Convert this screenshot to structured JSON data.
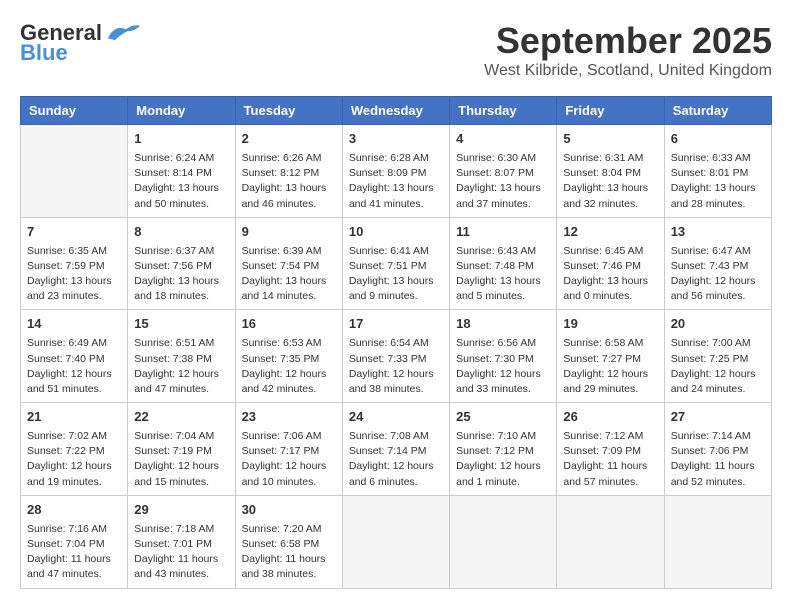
{
  "header": {
    "logo_main": "General",
    "logo_sub": "Blue",
    "month_title": "September 2025",
    "subtitle": "West Kilbride, Scotland, United Kingdom"
  },
  "weekdays": [
    "Sunday",
    "Monday",
    "Tuesday",
    "Wednesday",
    "Thursday",
    "Friday",
    "Saturday"
  ],
  "weeks": [
    [
      {
        "day": "",
        "info": ""
      },
      {
        "day": "1",
        "info": "Sunrise: 6:24 AM\nSunset: 8:14 PM\nDaylight: 13 hours\nand 50 minutes."
      },
      {
        "day": "2",
        "info": "Sunrise: 6:26 AM\nSunset: 8:12 PM\nDaylight: 13 hours\nand 46 minutes."
      },
      {
        "day": "3",
        "info": "Sunrise: 6:28 AM\nSunset: 8:09 PM\nDaylight: 13 hours\nand 41 minutes."
      },
      {
        "day": "4",
        "info": "Sunrise: 6:30 AM\nSunset: 8:07 PM\nDaylight: 13 hours\nand 37 minutes."
      },
      {
        "day": "5",
        "info": "Sunrise: 6:31 AM\nSunset: 8:04 PM\nDaylight: 13 hours\nand 32 minutes."
      },
      {
        "day": "6",
        "info": "Sunrise: 6:33 AM\nSunset: 8:01 PM\nDaylight: 13 hours\nand 28 minutes."
      }
    ],
    [
      {
        "day": "7",
        "info": "Sunrise: 6:35 AM\nSunset: 7:59 PM\nDaylight: 13 hours\nand 23 minutes."
      },
      {
        "day": "8",
        "info": "Sunrise: 6:37 AM\nSunset: 7:56 PM\nDaylight: 13 hours\nand 18 minutes."
      },
      {
        "day": "9",
        "info": "Sunrise: 6:39 AM\nSunset: 7:54 PM\nDaylight: 13 hours\nand 14 minutes."
      },
      {
        "day": "10",
        "info": "Sunrise: 6:41 AM\nSunset: 7:51 PM\nDaylight: 13 hours\nand 9 minutes."
      },
      {
        "day": "11",
        "info": "Sunrise: 6:43 AM\nSunset: 7:48 PM\nDaylight: 13 hours\nand 5 minutes."
      },
      {
        "day": "12",
        "info": "Sunrise: 6:45 AM\nSunset: 7:46 PM\nDaylight: 13 hours\nand 0 minutes."
      },
      {
        "day": "13",
        "info": "Sunrise: 6:47 AM\nSunset: 7:43 PM\nDaylight: 12 hours\nand 56 minutes."
      }
    ],
    [
      {
        "day": "14",
        "info": "Sunrise: 6:49 AM\nSunset: 7:40 PM\nDaylight: 12 hours\nand 51 minutes."
      },
      {
        "day": "15",
        "info": "Sunrise: 6:51 AM\nSunset: 7:38 PM\nDaylight: 12 hours\nand 47 minutes."
      },
      {
        "day": "16",
        "info": "Sunrise: 6:53 AM\nSunset: 7:35 PM\nDaylight: 12 hours\nand 42 minutes."
      },
      {
        "day": "17",
        "info": "Sunrise: 6:54 AM\nSunset: 7:33 PM\nDaylight: 12 hours\nand 38 minutes."
      },
      {
        "day": "18",
        "info": "Sunrise: 6:56 AM\nSunset: 7:30 PM\nDaylight: 12 hours\nand 33 minutes."
      },
      {
        "day": "19",
        "info": "Sunrise: 6:58 AM\nSunset: 7:27 PM\nDaylight: 12 hours\nand 29 minutes."
      },
      {
        "day": "20",
        "info": "Sunrise: 7:00 AM\nSunset: 7:25 PM\nDaylight: 12 hours\nand 24 minutes."
      }
    ],
    [
      {
        "day": "21",
        "info": "Sunrise: 7:02 AM\nSunset: 7:22 PM\nDaylight: 12 hours\nand 19 minutes."
      },
      {
        "day": "22",
        "info": "Sunrise: 7:04 AM\nSunset: 7:19 PM\nDaylight: 12 hours\nand 15 minutes."
      },
      {
        "day": "23",
        "info": "Sunrise: 7:06 AM\nSunset: 7:17 PM\nDaylight: 12 hours\nand 10 minutes."
      },
      {
        "day": "24",
        "info": "Sunrise: 7:08 AM\nSunset: 7:14 PM\nDaylight: 12 hours\nand 6 minutes."
      },
      {
        "day": "25",
        "info": "Sunrise: 7:10 AM\nSunset: 7:12 PM\nDaylight: 12 hours\nand 1 minute."
      },
      {
        "day": "26",
        "info": "Sunrise: 7:12 AM\nSunset: 7:09 PM\nDaylight: 11 hours\nand 57 minutes."
      },
      {
        "day": "27",
        "info": "Sunrise: 7:14 AM\nSunset: 7:06 PM\nDaylight: 11 hours\nand 52 minutes."
      }
    ],
    [
      {
        "day": "28",
        "info": "Sunrise: 7:16 AM\nSunset: 7:04 PM\nDaylight: 11 hours\nand 47 minutes."
      },
      {
        "day": "29",
        "info": "Sunrise: 7:18 AM\nSunset: 7:01 PM\nDaylight: 11 hours\nand 43 minutes."
      },
      {
        "day": "30",
        "info": "Sunrise: 7:20 AM\nSunset: 6:58 PM\nDaylight: 11 hours\nand 38 minutes."
      },
      {
        "day": "",
        "info": ""
      },
      {
        "day": "",
        "info": ""
      },
      {
        "day": "",
        "info": ""
      },
      {
        "day": "",
        "info": ""
      }
    ]
  ]
}
